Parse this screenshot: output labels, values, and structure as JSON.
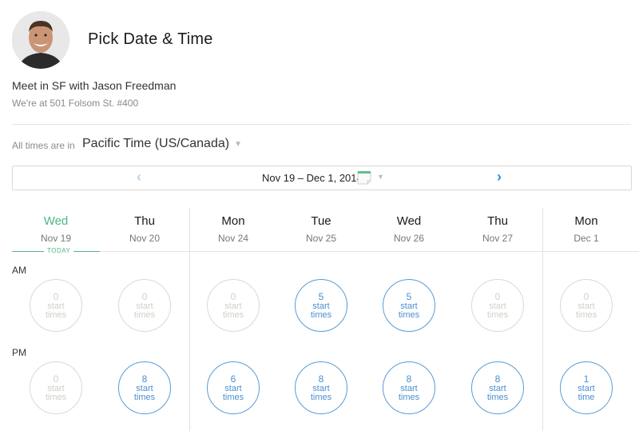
{
  "header": {
    "title": "Pick Date & Time",
    "avatar_icon": "user-photo",
    "event_name": "Meet in SF with Jason Freedman",
    "event_location": "We're at 501 Folsom St. #400"
  },
  "timezone": {
    "label": "All times are in",
    "selected": "Pacific Time (US/Canada)",
    "caret_icon": "caret-down-icon"
  },
  "date_nav": {
    "range": "Nov 19 – Dec 1, 2014",
    "prev_icon": "chevron-left-icon",
    "next_icon": "chevron-right-icon",
    "calendar_icon": "calendar-icon",
    "prev_enabled": false,
    "next_enabled": true
  },
  "today_label": "TODAY",
  "periods": [
    "AM",
    "PM"
  ],
  "colors": {
    "today": "#4fb683",
    "available": "#4a8fd0",
    "unavailable": "#d2cfc8"
  },
  "days": [
    {
      "name": "Wed",
      "date": "Nov 19",
      "today": true,
      "am": {
        "count": "0",
        "line1": "start",
        "line2": "times"
      },
      "pm": {
        "count": "0",
        "line1": "start",
        "line2": "times"
      }
    },
    {
      "name": "Thu",
      "date": "Nov 20",
      "today": false,
      "am": {
        "count": "0",
        "line1": "start",
        "line2": "times"
      },
      "pm": {
        "count": "8",
        "line1": "start",
        "line2": "times"
      }
    },
    {
      "name": "Mon",
      "date": "Nov 24",
      "today": false,
      "am": {
        "count": "0",
        "line1": "start",
        "line2": "times"
      },
      "pm": {
        "count": "6",
        "line1": "start",
        "line2": "times"
      }
    },
    {
      "name": "Tue",
      "date": "Nov 25",
      "today": false,
      "am": {
        "count": "5",
        "line1": "start",
        "line2": "times"
      },
      "pm": {
        "count": "8",
        "line1": "start",
        "line2": "times"
      }
    },
    {
      "name": "Wed",
      "date": "Nov 26",
      "today": false,
      "am": {
        "count": "5",
        "line1": "start",
        "line2": "times"
      },
      "pm": {
        "count": "8",
        "line1": "start",
        "line2": "times"
      }
    },
    {
      "name": "Thu",
      "date": "Nov 27",
      "today": false,
      "am": {
        "count": "0",
        "line1": "start",
        "line2": "times"
      },
      "pm": {
        "count": "8",
        "line1": "start",
        "line2": "times"
      }
    },
    {
      "name": "Mon",
      "date": "Dec 1",
      "today": false,
      "am": {
        "count": "0",
        "line1": "start",
        "line2": "times"
      },
      "pm": {
        "count": "1",
        "line1": "start",
        "line2": "time"
      }
    }
  ]
}
